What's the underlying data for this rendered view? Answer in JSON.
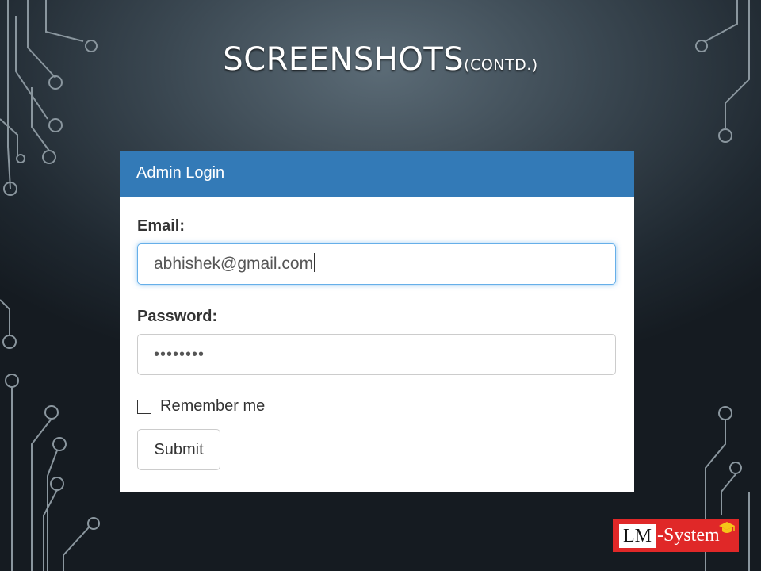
{
  "slide": {
    "title": "SCREENSHOTS",
    "subtitle": "(CONTD.)"
  },
  "login_panel": {
    "heading": "Admin Login",
    "email_label": "Email:",
    "email_value": "abhishek@gmail.com",
    "password_label": "Password:",
    "password_value": "••••••••",
    "remember_label": "Remember me",
    "remember_checked": false,
    "submit_label": "Submit"
  },
  "logo": {
    "lm_text": "LM",
    "system_text": "-System",
    "icon": "graduation-cap-icon"
  },
  "colors": {
    "panel_heading": "#337ab7",
    "logo_background": "#e02828",
    "focus_border": "#66afe9"
  }
}
